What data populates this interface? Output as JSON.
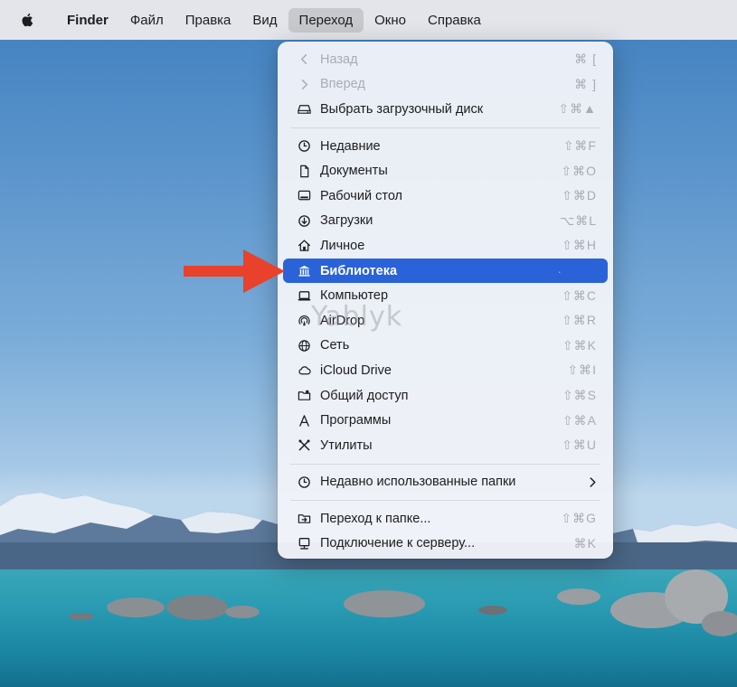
{
  "menubar": {
    "apple_icon": "apple-logo-icon",
    "items": [
      {
        "label": "Finder"
      },
      {
        "label": "Файл"
      },
      {
        "label": "Правка"
      },
      {
        "label": "Вид"
      },
      {
        "label": "Переход"
      },
      {
        "label": "Окно"
      },
      {
        "label": "Справка"
      }
    ],
    "active_item": "Переход"
  },
  "menu": {
    "items": [
      {
        "label": "Назад",
        "shortcut": "⌘ [",
        "icon": "chevron-left-icon",
        "disabled": true
      },
      {
        "label": "Вперед",
        "shortcut": "⌘ ]",
        "icon": "chevron-right-icon",
        "disabled": true
      },
      {
        "label": "Выбрать загрузочный диск",
        "shortcut": "⇧⌘▲",
        "icon": "disk-icon"
      },
      {
        "label": "Недавние",
        "shortcut": "⇧⌘F",
        "icon": "clock-icon"
      },
      {
        "label": "Документы",
        "shortcut": "⇧⌘O",
        "icon": "document-icon"
      },
      {
        "label": "Рабочий стол",
        "shortcut": "⇧⌘D",
        "icon": "desktop-icon"
      },
      {
        "label": "Загрузки",
        "shortcut": "⌥⌘L",
        "icon": "download-icon"
      },
      {
        "label": "Личное",
        "shortcut": "⇧⌘H",
        "icon": "home-icon"
      },
      {
        "label": "Библиотека",
        "shortcut": "·",
        "icon": "library-icon",
        "highlighted": true
      },
      {
        "label": "Компьютер",
        "shortcut": "⇧⌘C",
        "icon": "laptop-icon"
      },
      {
        "label": "AirDrop",
        "shortcut": "⇧⌘R",
        "icon": "airdrop-icon"
      },
      {
        "label": "Сеть",
        "shortcut": "⇧⌘K",
        "icon": "globe-icon"
      },
      {
        "label": "iCloud Drive",
        "shortcut": "⇧⌘I",
        "icon": "cloud-icon"
      },
      {
        "label": "Общий доступ",
        "shortcut": "⇧⌘S",
        "icon": "shared-folder-icon"
      },
      {
        "label": "Программы",
        "shortcut": "⇧⌘A",
        "icon": "applications-icon"
      },
      {
        "label": "Утилиты",
        "shortcut": "⇧⌘U",
        "icon": "utilities-icon"
      },
      {
        "label": "Недавно использованные папки",
        "icon": "clock-icon",
        "submenu": true
      },
      {
        "label": "Переход к папке...",
        "shortcut": "⇧⌘G",
        "icon": "go-folder-icon"
      },
      {
        "label": "Подключение к серверу...",
        "shortcut": "⌘K",
        "icon": "server-icon"
      }
    ]
  },
  "watermark": "Yablyk",
  "colors": {
    "highlight": "#2a62d8",
    "arrow": "#e8412c",
    "menubar_bg": "#e8e8eb",
    "menu_bg": "#f0f3f8"
  }
}
